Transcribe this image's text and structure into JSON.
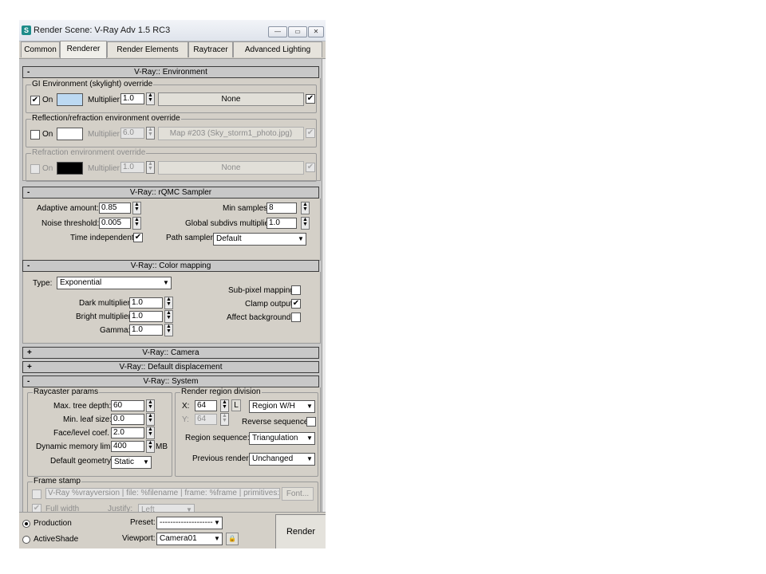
{
  "window": {
    "title": "Render Scene: V-Ray Adv 1.5 RC3",
    "app_icon": "S"
  },
  "tabs": [
    "Common",
    "Renderer",
    "Render Elements",
    "Raytracer",
    "Advanced Lighting"
  ],
  "environment": {
    "header": "V-Ray:: Environment",
    "sign": "-",
    "gi_group": "GI Environment (skylight) override",
    "gi_on": "On",
    "gi_color": "#bcd9f2",
    "gi_multiplier_label": "Multiplier:",
    "gi_multiplier": "1.0",
    "gi_map": "None",
    "refl_group": "Reflection/refraction environment override",
    "refl_on": "On",
    "refl_color": "#ffffff",
    "refl_multiplier_label": "Multiplier:",
    "refl_multiplier": "6.0",
    "refl_map": "Map #203 (Sky_storm1_photo.jpg)",
    "refr_group": "Refraction environment override",
    "refr_on": "On",
    "refr_color": "#000000",
    "refr_multiplier_label": "Multiplier:",
    "refr_multiplier": "1.0",
    "refr_map": "None"
  },
  "qmc": {
    "header": "V-Ray:: rQMC Sampler",
    "sign": "-",
    "adaptive_label": "Adaptive amount:",
    "adaptive_value": "0.85",
    "noise_label": "Noise threshold:",
    "noise_value": "0.005",
    "time_label": "Time independent",
    "min_samples_label": "Min samples:",
    "min_samples_value": "8",
    "global_subdivs_label": "Global subdivs multiplier:",
    "global_subdivs_value": "1.0",
    "path_sampler_label": "Path sampler:",
    "path_sampler_value": "Default"
  },
  "color_mapping": {
    "header": "V-Ray:: Color mapping",
    "sign": "-",
    "type_label": "Type:",
    "type_value": "Exponential",
    "dark_label": "Dark multiplier:",
    "dark_value": "1.0",
    "bright_label": "Bright multiplier:",
    "bright_value": "1.0",
    "gamma_label": "Gamma:",
    "gamma_value": "1.0",
    "subpixel_label": "Sub-pixel mapping",
    "clamp_label": "Clamp output",
    "affect_bg_label": "Affect background"
  },
  "camera": {
    "header": "V-Ray:: Camera",
    "sign": "+"
  },
  "displacement": {
    "header": "V-Ray:: Default displacement",
    "sign": "+"
  },
  "system": {
    "header": "V-Ray:: System",
    "sign": "-",
    "raycaster_group": "Raycaster params",
    "max_tree_label": "Max. tree depth:",
    "max_tree_value": "60",
    "min_leaf_label": "Min. leaf size:",
    "min_leaf_value": "0.0",
    "face_level_label": "Face/level coef.",
    "face_level_value": "2.0",
    "dyn_mem_label": "Dynamic memory limit:",
    "dyn_mem_value": "400",
    "dyn_mem_unit": "MB",
    "default_geom_label": "Default geometry:",
    "default_geom_value": "Static",
    "region_group": "Render region division",
    "x_label": "X:",
    "x_value": "64",
    "y_label": "Y:",
    "y_value": "64",
    "lock_label": "L",
    "region_wh": "Region W/H",
    "reverse_label": "Reverse sequence",
    "region_seq_label": "Region sequence:",
    "region_seq_value": "Triangulation",
    "prev_render_label": "Previous render:",
    "prev_render_value": "Unchanged",
    "frame_stamp_group": "Frame stamp",
    "frame_stamp_text": "V-Ray %vrayversion | file: %filename | frame: %frame | primitives: %primitiv",
    "font_button": "Font...",
    "full_width_label": "Full width",
    "justify_label": "Justify:",
    "justify_value": "Left"
  },
  "bottom": {
    "production_label": "Production",
    "activeshade_label": "ActiveShade",
    "preset_label": "Preset:",
    "preset_value": "--------------------",
    "viewport_label": "Viewport:",
    "viewport_value": "Camera01",
    "render_button": "Render"
  },
  "icons": {
    "check": "✔",
    "dropdown": "▼",
    "spin_up": "▲",
    "spin_down": "▼",
    "lock": "🔒"
  }
}
